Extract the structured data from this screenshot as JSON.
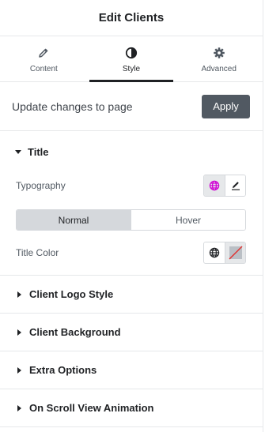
{
  "header": {
    "title": "Edit Clients"
  },
  "tabs": [
    {
      "label": "Content",
      "icon": "pencil-icon"
    },
    {
      "label": "Style",
      "icon": "contrast-icon",
      "active": true
    },
    {
      "label": "Advanced",
      "icon": "gear-icon"
    }
  ],
  "update_bar": {
    "text": "Update changes to page",
    "apply_label": "Apply"
  },
  "title_section": {
    "title": "Title",
    "typography_label": "Typography",
    "state_toggle": {
      "normal": "Normal",
      "hover": "Hover",
      "selected": "Normal"
    },
    "title_color_label": "Title Color"
  },
  "sections": [
    {
      "title": "Client Logo Style"
    },
    {
      "title": "Client Background"
    },
    {
      "title": "Extra Options"
    },
    {
      "title": "On Scroll View Animation"
    }
  ],
  "colors": {
    "accent_pink": "#d004d4",
    "button_dark": "#515962",
    "toggle_active": "#d5d8dc"
  }
}
